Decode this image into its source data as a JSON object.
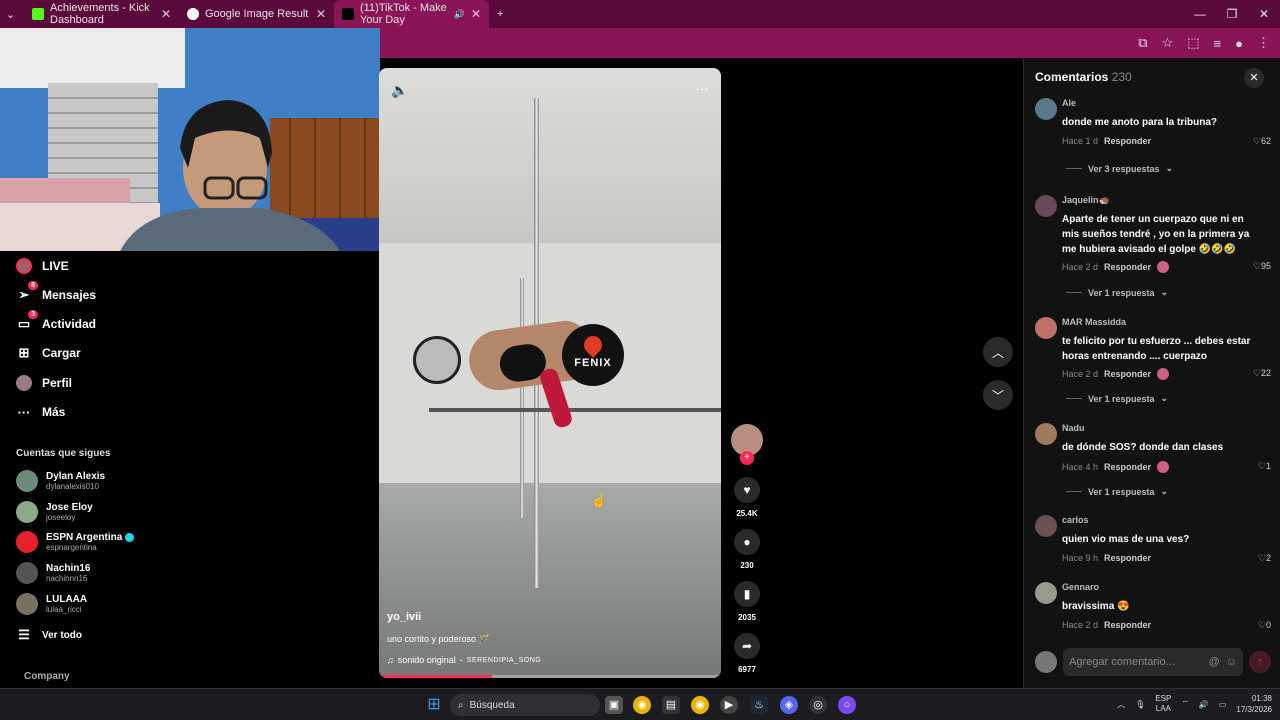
{
  "browser": {
    "tabs": [
      {
        "title": "Achievements - Kick Dashboard",
        "icon": "kick-icon",
        "color": "#53fc18"
      },
      {
        "title": "Google Image Result",
        "icon": "google-icon",
        "color": "#ffffff"
      },
      {
        "title": "(11)TikTok - Make Your Day",
        "icon": "tiktok-icon",
        "color": "#000000"
      }
    ],
    "new_tab": "+"
  },
  "sidebar": {
    "nav": [
      {
        "label": "LIVE",
        "icon": "live-icon",
        "badge": ""
      },
      {
        "label": "Mensajes",
        "icon": "messages-icon",
        "badge": "8"
      },
      {
        "label": "Actividad",
        "icon": "activity-icon",
        "badge": "3"
      },
      {
        "label": "Cargar",
        "icon": "upload-icon",
        "badge": ""
      },
      {
        "label": "Perfil",
        "icon": "profile-icon",
        "badge": ""
      },
      {
        "label": "Más",
        "icon": "more-icon",
        "badge": ""
      }
    ],
    "following_title": "Cuentas que sigues",
    "accounts": [
      {
        "name": "Dylan Alexis",
        "handle": "dylanalexis010",
        "verified": false
      },
      {
        "name": "Jose Eloy",
        "handle": "joseeloy",
        "verified": false
      },
      {
        "name": "ESPN Argentina",
        "handle": "espnargentina",
        "verified": true
      },
      {
        "name": "Nachin16",
        "handle": "nachinnn16",
        "verified": false
      },
      {
        "name": "LULAAA",
        "handle": "lulaa_ricci",
        "verified": false
      }
    ],
    "see_all": "Ver todo",
    "company": "Company"
  },
  "video": {
    "username": "yo_ivii",
    "description": "uno cortito y poderoso 🪄",
    "sound": "sonido original",
    "sound_author": "SERENDIPIA_SONG",
    "studio_logo": "FENIX",
    "progress": 0.33
  },
  "actions": {
    "likes": "25.4K",
    "comments": "230",
    "saves": "2035",
    "shares": "6977"
  },
  "comments_panel": {
    "title": "Comentarios",
    "count": "230",
    "items": [
      {
        "user": "Ale",
        "text": "donde me anoto para la tribuna?",
        "time": "Hace 1 d",
        "reply": "Responder",
        "likes": "62",
        "more": "Ver 3 respuestas",
        "creator_liked": false
      },
      {
        "user": "Jaquelin🦔",
        "text": "Aparte de tener un cuerpazo que ni en mis sueños tendré , yo en la primera ya me hubiera avisado el golpe 🤣🤣🤣",
        "time": "Hace 2 d",
        "reply": "Responder",
        "likes": "95",
        "more": "Ver 1 respuesta",
        "creator_liked": true
      },
      {
        "user": "MAR Massidda",
        "text": "te felicito por tu esfuerzo ... debes estar horas entrenando .... cuerpazo",
        "time": "Hace 2 d",
        "reply": "Responder",
        "likes": "22",
        "more": "Ver 1 respuesta",
        "creator_liked": true
      },
      {
        "user": "Nadu",
        "text": "de dónde SOS? donde dan clases",
        "time": "Hace 4 h",
        "reply": "Responder",
        "likes": "1",
        "more": "Ver 1 respuesta",
        "creator_liked": true
      },
      {
        "user": "carlos",
        "text": "quien vio mas de una ves?",
        "time": "Hace 9 h",
        "reply": "Responder",
        "likes": "2",
        "more": "",
        "creator_liked": false
      },
      {
        "user": "Gennaro",
        "text": "bravissima 😍",
        "time": "Hace 2 d",
        "reply": "Responder",
        "likes": "0",
        "more": "",
        "creator_liked": false
      }
    ],
    "input_placeholder": "Agregar comentario..."
  },
  "taskbar": {
    "search": "Búsqueda",
    "lang": "ESP",
    "region": "LAA",
    "time": "01:38",
    "date": "17/3/2026"
  }
}
